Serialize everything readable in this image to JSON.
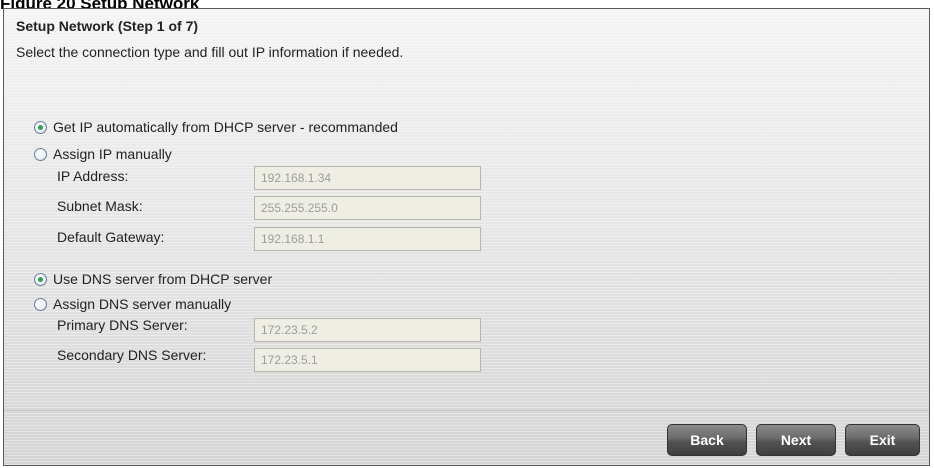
{
  "caption": "Figure 20   Setup Network",
  "header": {
    "title": "Setup Network (Step 1 of 7)",
    "subtitle": "Select the connection type and fill out IP information if needed."
  },
  "ip": {
    "option_dhcp": "Get IP automatically from DHCP server - recommanded",
    "option_dhcp_selected": true,
    "option_manual": "Assign IP manually",
    "option_manual_selected": false,
    "fields": {
      "ip_address": {
        "label": "IP Address:",
        "value": "192.168.1.34"
      },
      "subnet_mask": {
        "label": "Subnet Mask:",
        "value": "255.255.255.0"
      },
      "default_gateway": {
        "label": "Default Gateway:",
        "value": "192.168.1.1"
      }
    }
  },
  "dns": {
    "option_dhcp": "Use DNS server from DHCP server",
    "option_dhcp_selected": true,
    "option_manual": "Assign DNS server manually",
    "option_manual_selected": false,
    "fields": {
      "primary": {
        "label": "Primary DNS Server:",
        "value": "172.23.5.2"
      },
      "secondary": {
        "label": "Secondary DNS Server:",
        "value": "172.23.5.1"
      }
    }
  },
  "buttons": {
    "back": "Back",
    "next": "Next",
    "exit": "Exit"
  }
}
